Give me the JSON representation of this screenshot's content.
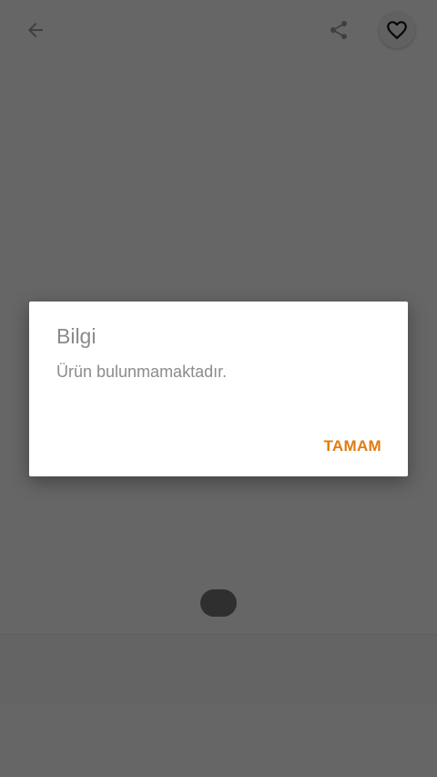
{
  "header": {
    "back_icon": "arrow-left-icon",
    "share_icon": "share-icon",
    "favorite_icon": "heart-outline-icon"
  },
  "dialog": {
    "title": "Bilgi",
    "message": "Ürün bulunmamaktadır.",
    "action_label": "TAMAM"
  },
  "colors": {
    "accent": "#e07b12",
    "scrim": "rgba(0,0,0,0.6)"
  }
}
